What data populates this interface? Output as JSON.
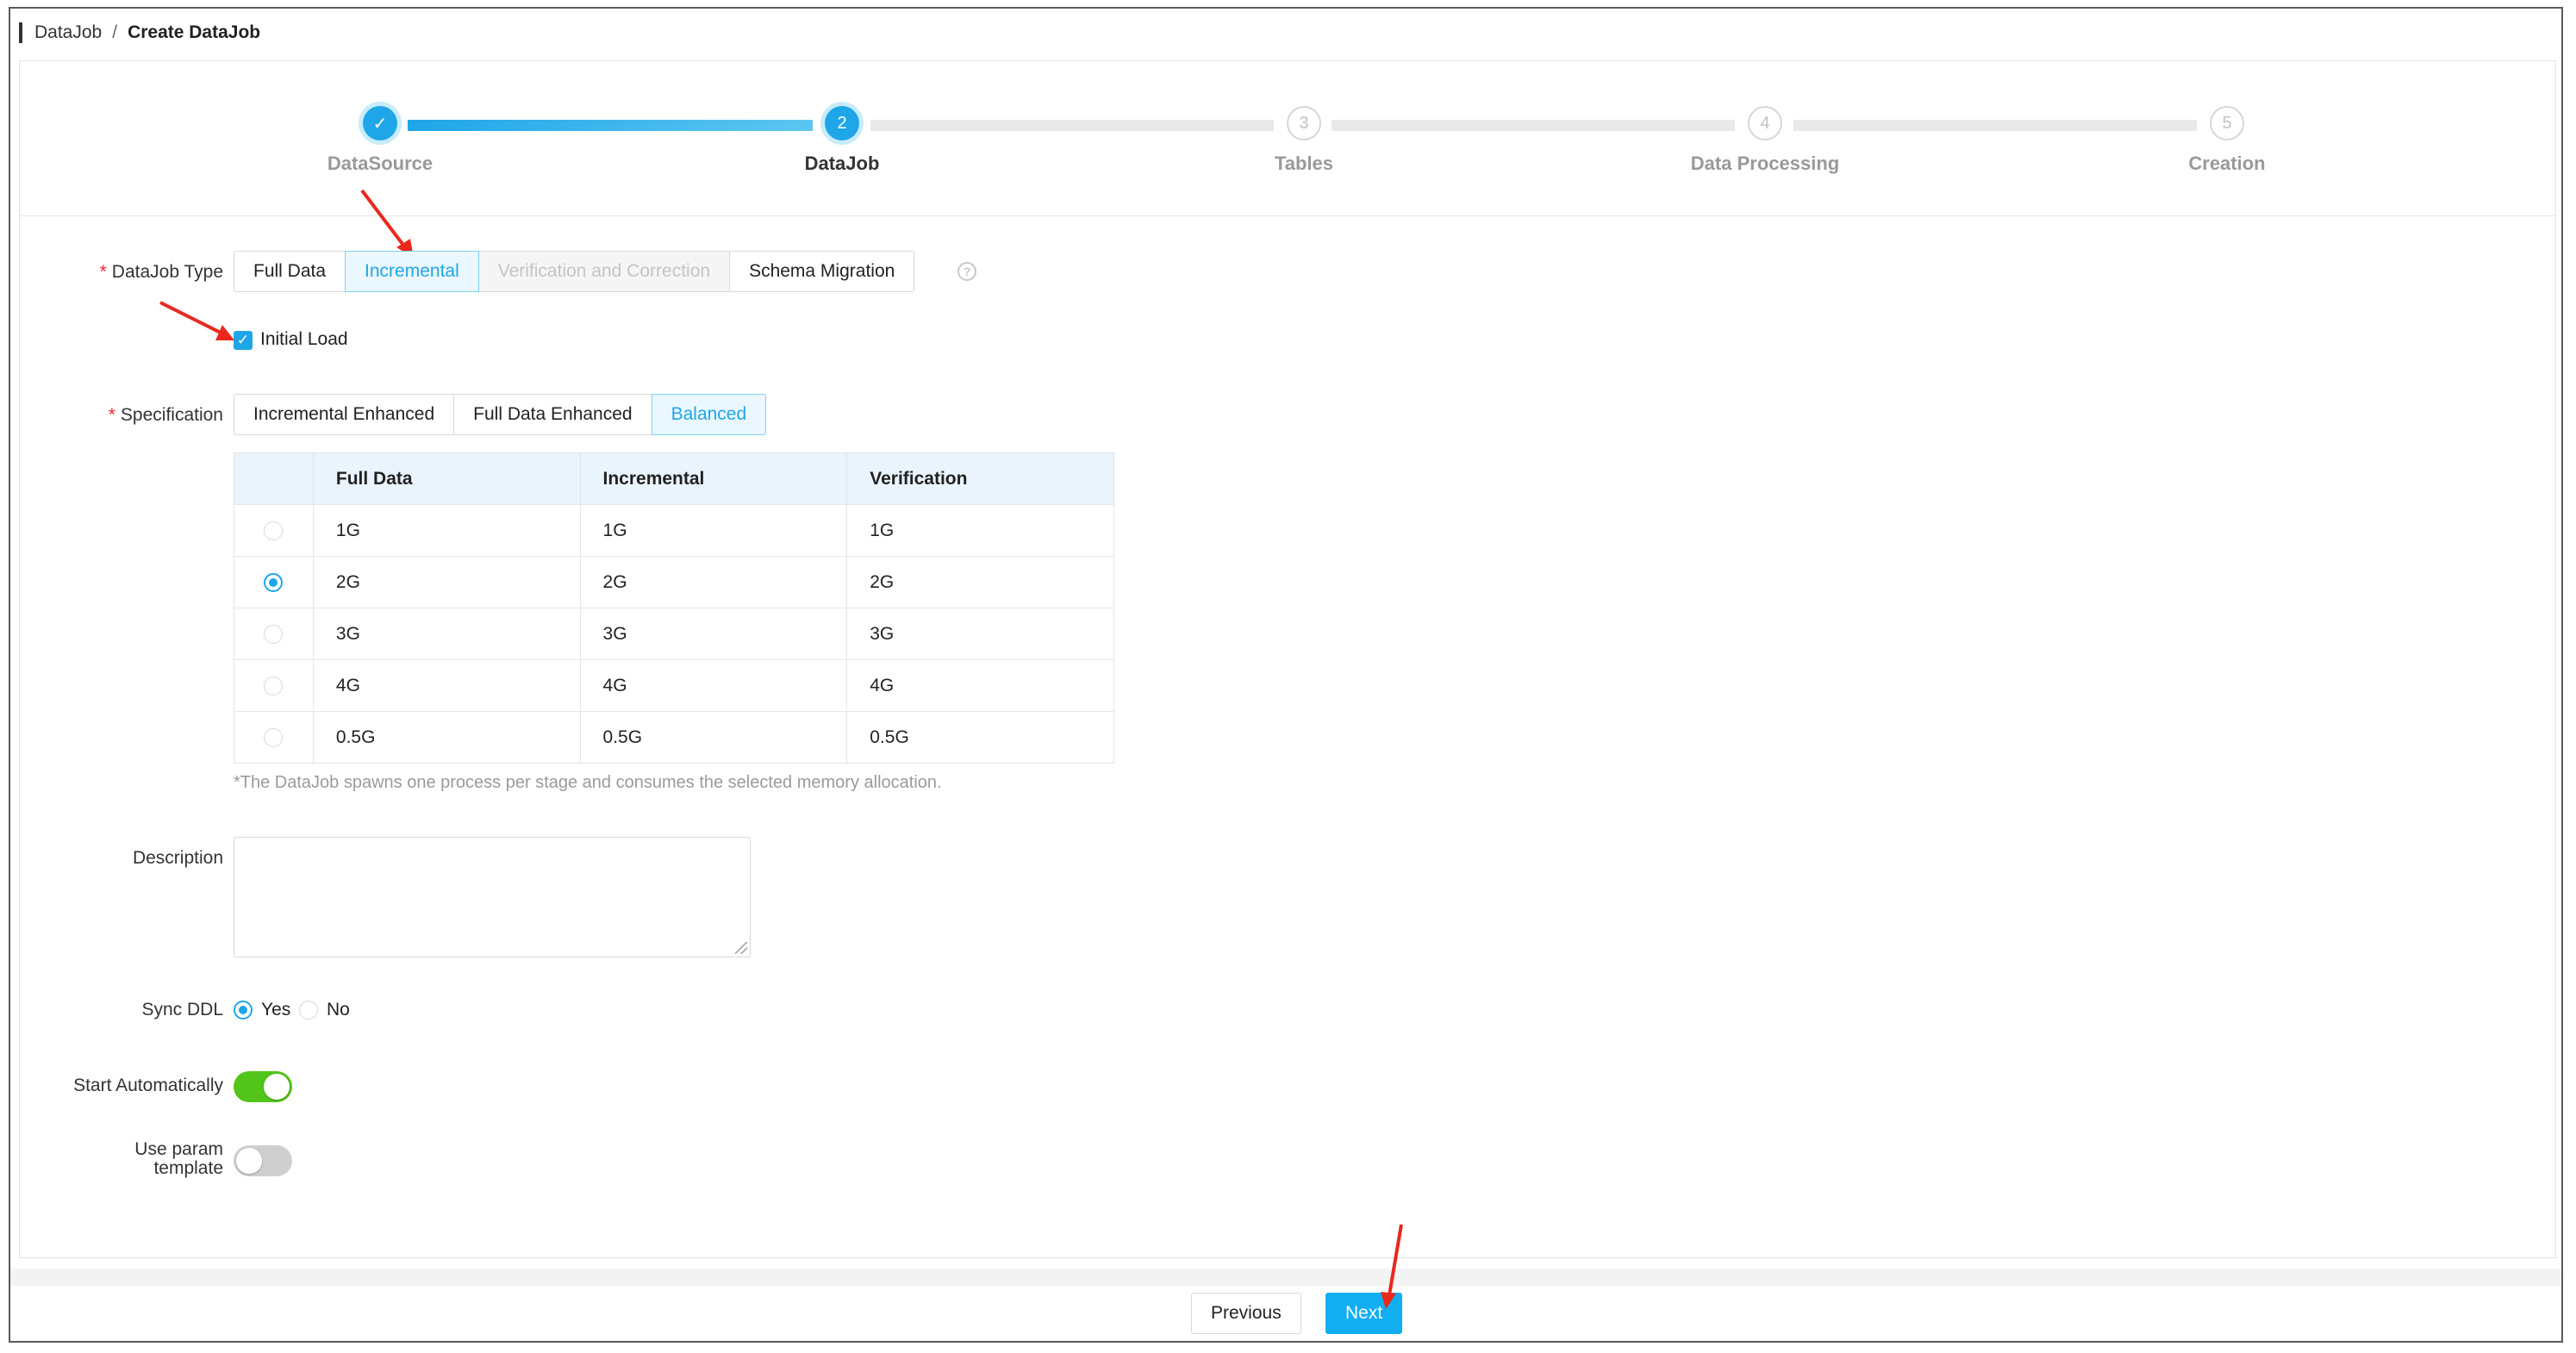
{
  "breadcrumb": {
    "parent": "DataJob",
    "separator": "/",
    "current": "Create DataJob"
  },
  "steps": [
    {
      "index": "1",
      "label": "DataSource",
      "status": "done"
    },
    {
      "index": "2",
      "label": "DataJob",
      "status": "active"
    },
    {
      "index": "3",
      "label": "Tables",
      "status": "todo"
    },
    {
      "index": "4",
      "label": "Data Processing",
      "status": "todo"
    },
    {
      "index": "5",
      "label": "Creation",
      "status": "todo"
    }
  ],
  "datajob_type": {
    "label": "DataJob Type",
    "options": [
      "Full Data",
      "Incremental",
      "Verification and Correction",
      "Schema Migration"
    ],
    "selected": "Incremental",
    "disabled": [
      "Verification and Correction"
    ],
    "help_icon": "question-circle-icon"
  },
  "initial_load": {
    "label": "Initial Load",
    "checked": true
  },
  "specification": {
    "label": "Specification",
    "options": [
      "Incremental Enhanced",
      "Full Data Enhanced",
      "Balanced"
    ],
    "selected": "Balanced",
    "table": {
      "headers": [
        "Full Data",
        "Incremental",
        "Verification"
      ],
      "rows": [
        {
          "selected": false,
          "cells": [
            "1G",
            "1G",
            "1G"
          ]
        },
        {
          "selected": true,
          "cells": [
            "2G",
            "2G",
            "2G"
          ]
        },
        {
          "selected": false,
          "cells": [
            "3G",
            "3G",
            "3G"
          ]
        },
        {
          "selected": false,
          "cells": [
            "4G",
            "4G",
            "4G"
          ]
        },
        {
          "selected": false,
          "cells": [
            "0.5G",
            "0.5G",
            "0.5G"
          ]
        }
      ]
    },
    "note": "*The DataJob spawns one process per stage and consumes the selected memory allocation."
  },
  "description": {
    "label": "Description",
    "value": ""
  },
  "sync_ddl": {
    "label": "Sync DDL",
    "options": [
      "Yes",
      "No"
    ],
    "selected": "Yes"
  },
  "start_automatically": {
    "label": "Start Automatically",
    "on": true
  },
  "use_param_template": {
    "label_line1": "Use param",
    "label_line2": "template",
    "on": false
  },
  "footer": {
    "previous_label": "Previous",
    "next_label": "Next"
  },
  "colors": {
    "primary": "#1fa6e8",
    "required": "#f5222d",
    "switch_on": "#52c41a",
    "annotation_arrow": "#e8291c"
  }
}
